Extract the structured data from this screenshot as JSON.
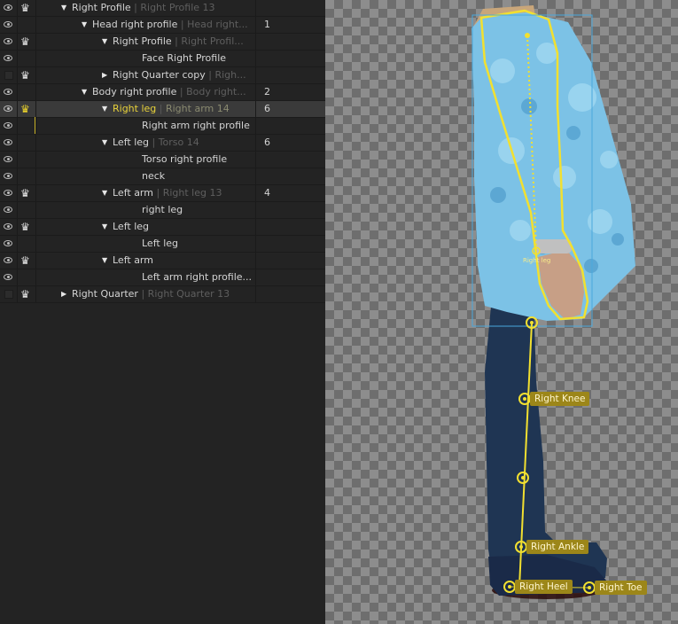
{
  "layers": [
    {
      "eye": true,
      "crown": true,
      "expand": "open",
      "name": "Right Profile",
      "ref": "Right Profile 13",
      "num": "",
      "selected": false
    },
    {
      "eye": true,
      "crown": false,
      "expand": "open",
      "name": "Head right profile",
      "ref": "Head right...",
      "num": "1",
      "selected": false
    },
    {
      "eye": true,
      "crown": true,
      "expand": "open",
      "name": "Right Profile",
      "ref": "Right Profil...",
      "num": "",
      "selected": false
    },
    {
      "eye": true,
      "crown": false,
      "expand": "none",
      "name": "Face Right Profile",
      "ref": "",
      "num": "",
      "selected": false
    },
    {
      "eye": false,
      "crown": true,
      "expand": "closed",
      "name": "Right Quarter copy",
      "ref": "Righ...",
      "num": "",
      "selected": false
    },
    {
      "eye": true,
      "crown": false,
      "expand": "open",
      "name": "Body right profile",
      "ref": "Body right...",
      "num": "2",
      "selected": false
    },
    {
      "eye": true,
      "crown": true,
      "expand": "open",
      "name": "Right leg",
      "ref": "Right arm 14",
      "num": "6",
      "selected": true
    },
    {
      "eye": true,
      "crown": false,
      "expand": "none",
      "name": "Right arm right profile",
      "ref": "",
      "num": "",
      "selected": false
    },
    {
      "eye": true,
      "crown": false,
      "expand": "open",
      "name": "Left leg",
      "ref": "Torso 14",
      "num": "6",
      "selected": false
    },
    {
      "eye": true,
      "crown": false,
      "expand": "none",
      "name": "Torso right profile",
      "ref": "",
      "num": "",
      "selected": false
    },
    {
      "eye": true,
      "crown": false,
      "expand": "none",
      "name": "neck",
      "ref": "",
      "num": "",
      "selected": false
    },
    {
      "eye": true,
      "crown": true,
      "expand": "open",
      "name": "Left arm",
      "ref": "Right leg 13",
      "num": "4",
      "selected": false
    },
    {
      "eye": true,
      "crown": false,
      "expand": "none",
      "name": "right leg",
      "ref": "",
      "num": "",
      "selected": false
    },
    {
      "eye": true,
      "crown": true,
      "expand": "open",
      "name": "Left leg",
      "ref": "",
      "num": "",
      "selected": false
    },
    {
      "eye": true,
      "crown": false,
      "expand": "none",
      "name": "Left leg",
      "ref": "",
      "num": "",
      "selected": false
    },
    {
      "eye": true,
      "crown": true,
      "expand": "open",
      "name": "Left arm",
      "ref": "",
      "num": "",
      "selected": false
    },
    {
      "eye": true,
      "crown": false,
      "expand": "none",
      "name": "Left arm right profile...",
      "ref": "",
      "num": "",
      "selected": false
    },
    {
      "eye": false,
      "crown": true,
      "expand": "closed",
      "name": "Right Quarter",
      "ref": "Right Quarter 13",
      "num": "",
      "selected": false
    }
  ],
  "bones": {
    "knee": "Right Knee",
    "ankle": "Right Ankle",
    "heel": "Right Heel",
    "toe": "Right Toe",
    "selected_small": "Right leg"
  },
  "colors": {
    "accent_yellow": "#f2e030",
    "selection_blue": "#4aa8dc",
    "bone_label_bg": "#9c8619"
  }
}
